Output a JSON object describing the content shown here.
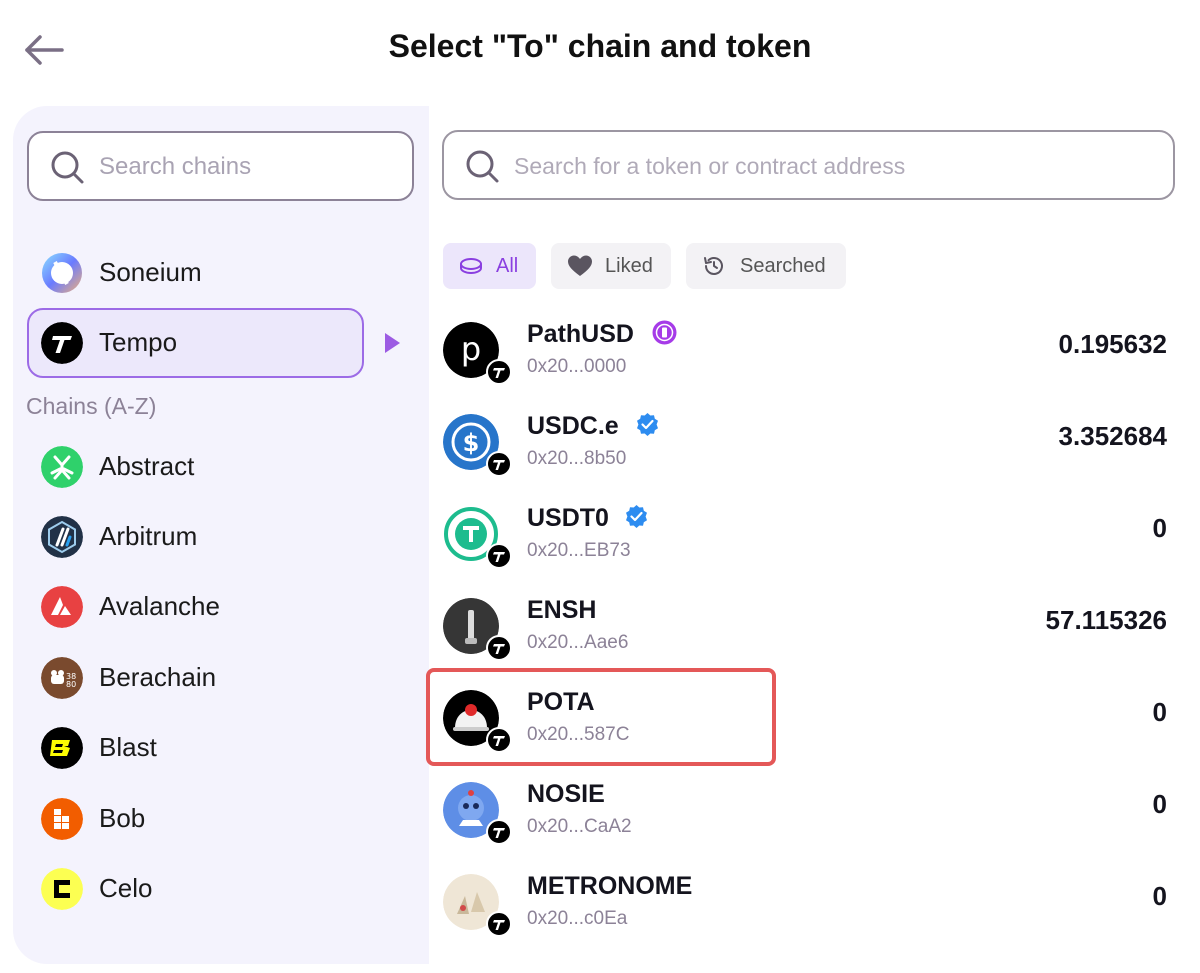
{
  "header": {
    "title": "Select \"To\" chain and token"
  },
  "chain_search": {
    "placeholder": "Search chains"
  },
  "chains_pinned": [
    {
      "name": "Soneium",
      "selected": false
    },
    {
      "name": "Tempo",
      "selected": true
    }
  ],
  "chains_section_label": "Chains (A-Z)",
  "chains": [
    {
      "name": "Abstract"
    },
    {
      "name": "Arbitrum"
    },
    {
      "name": "Avalanche"
    },
    {
      "name": "Berachain"
    },
    {
      "name": "Blast"
    },
    {
      "name": "Bob"
    },
    {
      "name": "Celo"
    }
  ],
  "token_search": {
    "placeholder": "Search for a token or contract address"
  },
  "filter_tabs": [
    {
      "label": "All",
      "active": true
    },
    {
      "label": "Liked",
      "active": false
    },
    {
      "label": "Searched",
      "active": false
    }
  ],
  "tokens": [
    {
      "symbol": "PathUSD",
      "address": "0x20...0000",
      "balance": "0.195632"
    },
    {
      "symbol": "USDC.e",
      "address": "0x20...8b50",
      "balance": "3.352684"
    },
    {
      "symbol": "USDT0",
      "address": "0x20...EB73",
      "balance": "0"
    },
    {
      "symbol": "ENSH",
      "address": "0x20...Aae6",
      "balance": "57.115326"
    },
    {
      "symbol": "POTA",
      "address": "0x20...587C",
      "balance": "0"
    },
    {
      "symbol": "NOSIE",
      "address": "0x20...CaA2",
      "balance": "0"
    },
    {
      "symbol": "METRONOME",
      "address": "0x20...c0Ea",
      "balance": "0"
    }
  ],
  "colors": {
    "accent": "#9c6be6",
    "panel_bg": "#f4f3fd",
    "highlight": "#e45858",
    "muted_text": "#8c8297"
  }
}
